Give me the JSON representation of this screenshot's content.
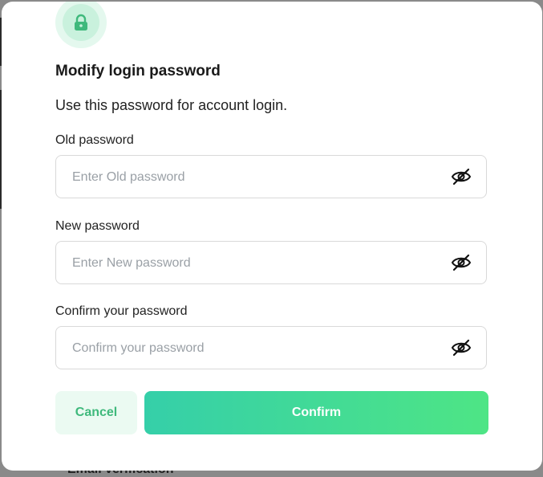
{
  "background": {
    "behind_text": "Email verification"
  },
  "modal": {
    "title": "Modify login password",
    "subtitle": "Use this password for account login.",
    "fields": [
      {
        "label": "Old password",
        "placeholder": "Enter Old password",
        "value": ""
      },
      {
        "label": "New password",
        "placeholder": "Enter New password",
        "value": ""
      },
      {
        "label": "Confirm your password",
        "placeholder": "Confirm your password",
        "value": ""
      }
    ],
    "icons": {
      "badge": "lock-icon",
      "toggle": "eye-off-icon"
    },
    "buttons": {
      "cancel": "Cancel",
      "confirm": "Confirm"
    },
    "colors": {
      "accent": "#3fb97c",
      "badge_outer": "#e4f8ee",
      "badge_inner": "#c9f1dd",
      "confirm_gradient_start": "#35cfa9",
      "confirm_gradient_end": "#4ee585",
      "cancel_bg": "#ebfaf2"
    }
  }
}
